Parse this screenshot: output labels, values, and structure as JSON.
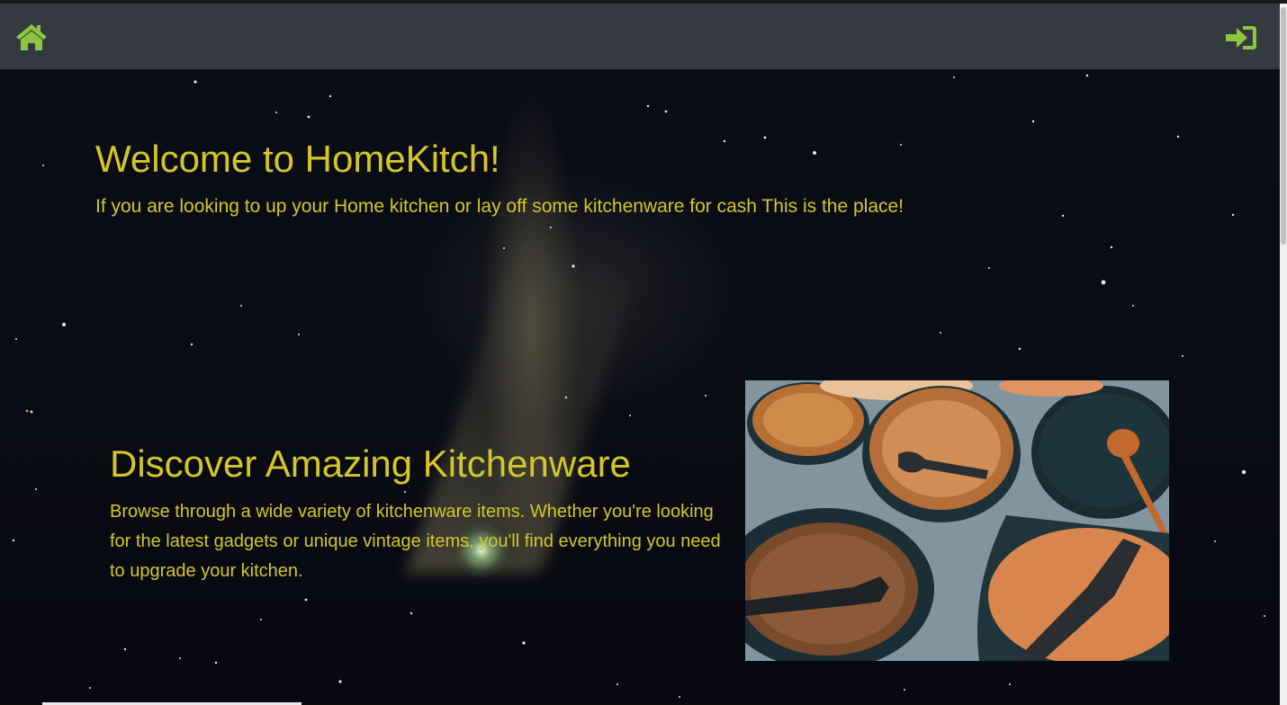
{
  "navbar": {
    "home_icon": "home-icon",
    "login_icon": "sign-in-icon",
    "icon_color": "#8cc63f",
    "background": "#343a40"
  },
  "welcome": {
    "title": "Welcome to HomeKitch!",
    "subtitle": "If you are looking to up your Home kitchen or lay off some kitchenware for cash This is the place!"
  },
  "discover": {
    "title": "Discover Amazing Kitchenware",
    "text": "Browse through a wide variety of kitchenware items. Whether you're looking for the latest gadgets or unique vintage items, you'll find everything you need to upgrade your kitchen."
  },
  "colors": {
    "text_accent": "#d4c62a",
    "hero_background": "#0a0c14"
  }
}
